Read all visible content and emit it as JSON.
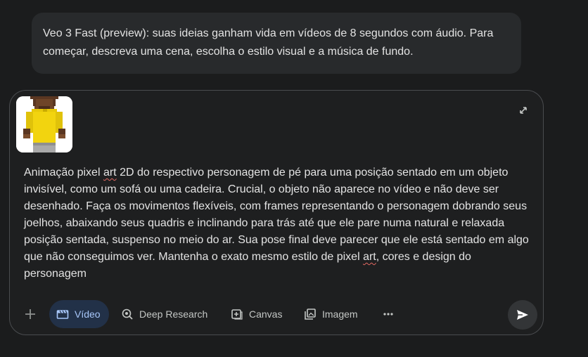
{
  "notice": {
    "text": "Veo 3 Fast (preview): suas ideias ganham vida em vídeos de 8 segundos com áudio. Para começar, descreva uma cena, escolha o estilo visual e a música de fundo."
  },
  "composer": {
    "attachment_icon": "pixel-art-character-thumbnail",
    "expand_icon": "expand-icon",
    "prompt": {
      "p1": "Animação pixel ",
      "w1": "art",
      "p2": " 2D do respectivo personagem de pé para uma posição sentado em um objeto invisível, como um sofá ou uma cadeira. Crucial, o objeto não aparece no vídeo e não deve ser desenhado. Faça os movimentos flexíveis, com frames representando o personagem dobrando seus joelhos, abaixando seus quadris e inclinando para trás até que ele pare numa natural e relaxada posição sentada, suspenso no meio do ar. Sua pose final deve parecer que ele está sentado em algo que não conseguimos ver. Mantenha o exato mesmo estilo de pixel ",
      "w2": "art",
      "p3": ", cores e design do personagem"
    }
  },
  "toolbar": {
    "add_icon": "plus-icon",
    "tools": {
      "video": {
        "label": "Vídeo",
        "icon": "clapperboard-icon",
        "active": true
      },
      "deep_research": {
        "label": "Deep Research",
        "icon": "deep-research-icon",
        "active": false
      },
      "canvas": {
        "label": "Canvas",
        "icon": "canvas-icon",
        "active": false
      },
      "imagem": {
        "label": "Imagem",
        "icon": "image-gallery-icon",
        "active": false
      }
    },
    "more_icon": "more-dots-icon",
    "send_icon": "send-arrow-icon"
  },
  "colors": {
    "background": "#1b1c1d",
    "notice_bg": "#282a2c",
    "composer_bg": "#1e1f20",
    "active_tool_text": "#a8c7fa",
    "text": "#e3e3e3"
  }
}
